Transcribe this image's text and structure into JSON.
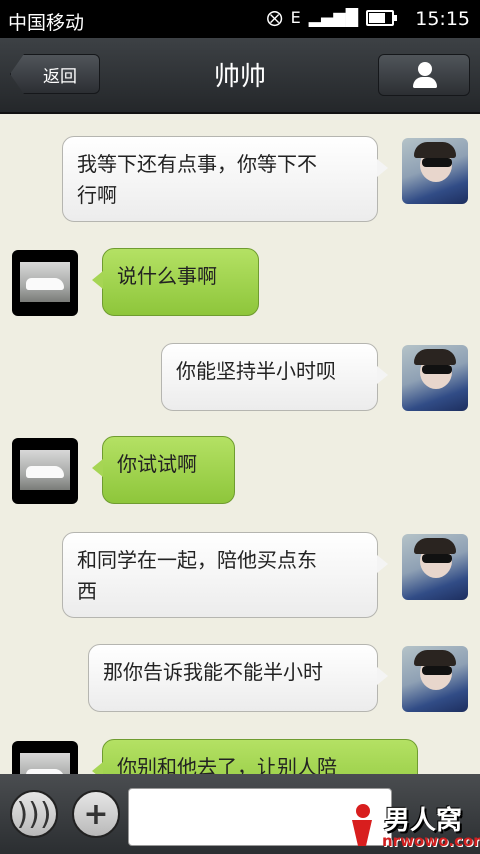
{
  "status_bar": {
    "carrier": "中国移动",
    "network": "E",
    "time": "15:15",
    "battery_level": 0.8
  },
  "header": {
    "title": "帅帅",
    "back_label": "返回"
  },
  "messages": [
    {
      "sender": "me",
      "text_line1": "我等下还有点事，你等下不",
      "text_line2": "行啊"
    },
    {
      "sender": "other",
      "text": "说什么事啊"
    },
    {
      "sender": "me",
      "text": "你能坚持半小时呗"
    },
    {
      "sender": "other",
      "text": "你试试啊"
    },
    {
      "sender": "me",
      "text_line1": "和同学在一起，陪他买点东",
      "text_line2": "西"
    },
    {
      "sender": "me",
      "text": "那你告诉我能不能半小时"
    },
    {
      "sender": "other",
      "text": "你别和他去了，让别人陪"
    }
  ],
  "input_bar": {
    "text_value": ""
  },
  "watermark": {
    "line1": "男人窝",
    "line2": "nrwowo.com"
  },
  "colors": {
    "title_bar": "#2f3236",
    "chat_background": "#efeee2",
    "my_bubble": "#ffffff",
    "other_bubble": "#9ccf45"
  }
}
